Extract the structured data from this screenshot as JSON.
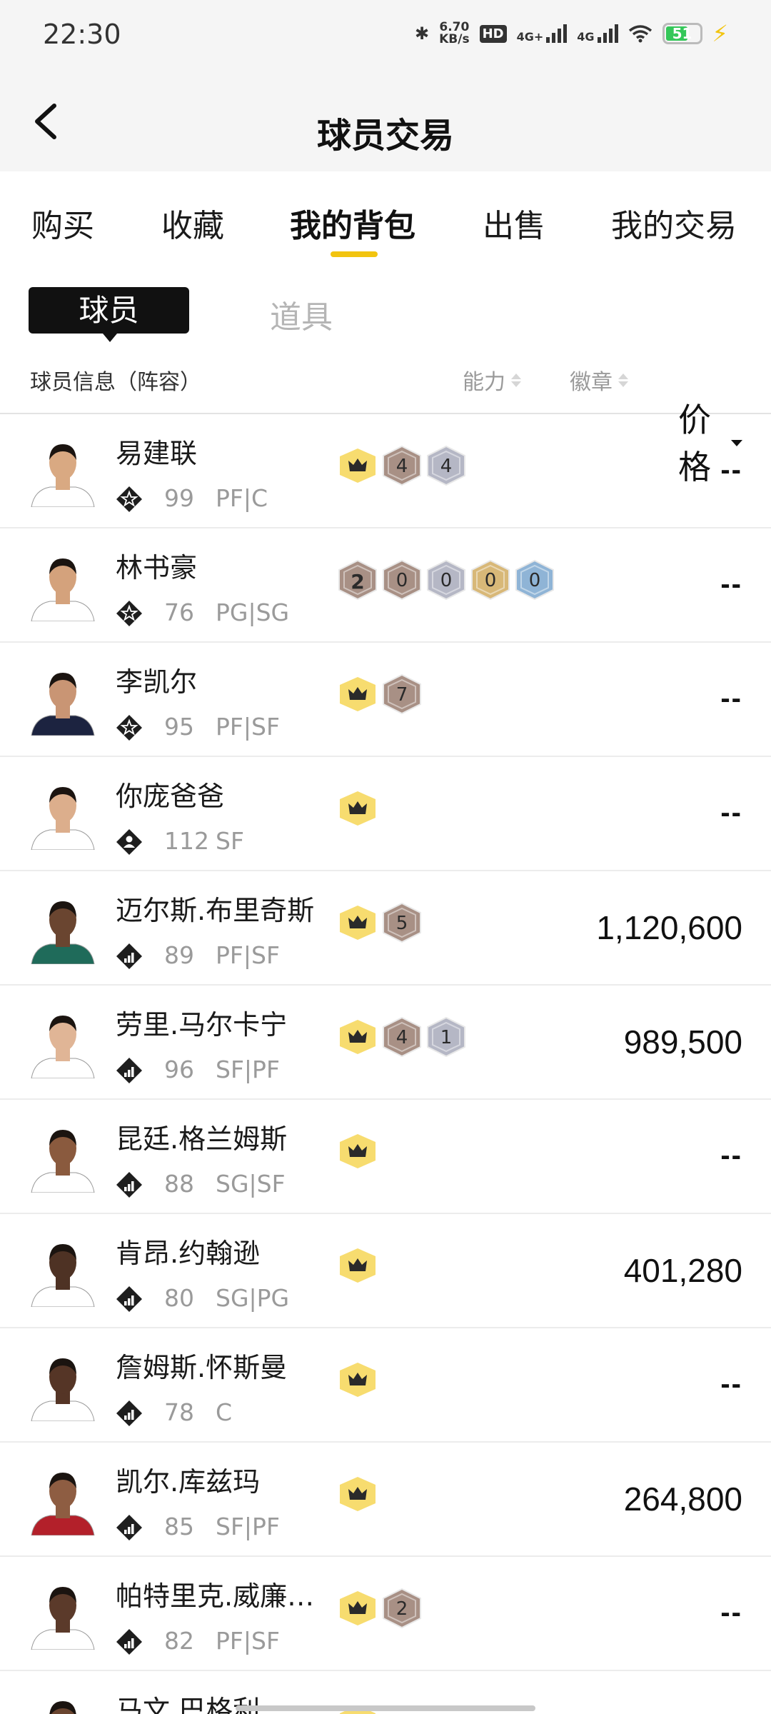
{
  "status_bar": {
    "time": "22:30",
    "net_speed_value": "6.70",
    "net_speed_unit": "KB/s",
    "hd_label": "HD",
    "sim1_label": "4G+",
    "sim2_label": "4G",
    "battery_level": "51"
  },
  "header": {
    "title": "球员交易"
  },
  "tabs": [
    {
      "label": "购买"
    },
    {
      "label": "收藏"
    },
    {
      "label": "我的背包"
    },
    {
      "label": "出售"
    },
    {
      "label": "我的交易"
    }
  ],
  "active_tab": "我的背包",
  "sub_tabs": {
    "player": "球员",
    "item": "道具"
  },
  "columns": {
    "info": "球员信息（阵容）",
    "ability": "能力",
    "badge": "徽章",
    "price": "价格"
  },
  "players": [
    {
      "name": "易建联",
      "rating": "99",
      "position": "PF|C",
      "tier": "star",
      "skin": "#d9a982",
      "jersey": "#ffffff",
      "badges": [
        {
          "kind": "crown"
        },
        {
          "kind": "hex",
          "num": "4",
          "color": "#a89085"
        },
        {
          "kind": "hex",
          "num": "4",
          "color": "#b5b7c5"
        }
      ],
      "price": "--"
    },
    {
      "name": "林书豪",
      "rating": "76",
      "position": "PG|SG",
      "tier": "star",
      "skin": "#d4a27c",
      "jersey": "#ffffff",
      "badges": [
        {
          "kind": "hex",
          "num": "2",
          "color": "#a89085",
          "bold": true
        },
        {
          "kind": "hex",
          "num": "0",
          "color": "#a89085"
        },
        {
          "kind": "hex",
          "num": "0",
          "color": "#b5b7c5"
        },
        {
          "kind": "hex",
          "num": "0",
          "color": "#d8b878"
        },
        {
          "kind": "hex",
          "num": "0",
          "color": "#8fb4d6"
        }
      ],
      "price": "--"
    },
    {
      "name": "李凯尔",
      "rating": "95",
      "position": "PF|SF",
      "tier": "star",
      "skin": "#c99574",
      "jersey": "#1c2340",
      "badges": [
        {
          "kind": "crown"
        },
        {
          "kind": "hex",
          "num": "7",
          "color": "#a89085"
        }
      ],
      "price": "--"
    },
    {
      "name": "你庞爸爸",
      "rating": "112",
      "position": "SF",
      "tier": "person",
      "skin": "#dcae8c",
      "jersey": "#ffffff",
      "badges": [
        {
          "kind": "crown"
        }
      ],
      "price": "--"
    },
    {
      "name": "迈尔斯.布里奇斯",
      "rating": "89",
      "position": "PF|SF",
      "tier": "bars",
      "skin": "#6a4530",
      "jersey": "#1f6b5a",
      "badges": [
        {
          "kind": "crown"
        },
        {
          "kind": "hex",
          "num": "5",
          "color": "#a89085"
        }
      ],
      "price": "1,120,600"
    },
    {
      "name": "劳里.马尔卡宁",
      "rating": "96",
      "position": "SF|PF",
      "tier": "bars",
      "skin": "#e0b596",
      "jersey": "#ffffff",
      "badges": [
        {
          "kind": "crown"
        },
        {
          "kind": "hex",
          "num": "4",
          "color": "#a89085"
        },
        {
          "kind": "hex",
          "num": "1",
          "color": "#b5b7c5"
        }
      ],
      "price": "989,500"
    },
    {
      "name": "昆廷.格兰姆斯",
      "rating": "88",
      "position": "SG|SF",
      "tier": "bars",
      "skin": "#8a5a3e",
      "jersey": "#ffffff",
      "badges": [
        {
          "kind": "crown"
        }
      ],
      "price": "--"
    },
    {
      "name": "肯昂.约翰逊",
      "rating": "80",
      "position": "SG|PG",
      "tier": "bars",
      "skin": "#4e3224",
      "jersey": "#ffffff",
      "badges": [
        {
          "kind": "crown"
        }
      ],
      "price": "401,280"
    },
    {
      "name": "詹姆斯.怀斯曼",
      "rating": "78",
      "position": "C",
      "tier": "bars",
      "skin": "#553526",
      "jersey": "#ffffff",
      "badges": [
        {
          "kind": "crown"
        }
      ],
      "price": "--"
    },
    {
      "name": "凯尔.库兹玛",
      "rating": "85",
      "position": "SF|PF",
      "tier": "bars",
      "skin": "#8e5d42",
      "jersey": "#b3202a",
      "badges": [
        {
          "kind": "crown"
        }
      ],
      "price": "264,800"
    },
    {
      "name": "帕特里克.威廉…",
      "rating": "82",
      "position": "PF|SF",
      "tier": "bars",
      "skin": "#5b3a2a",
      "jersey": "#ffffff",
      "badges": [
        {
          "kind": "crown"
        },
        {
          "kind": "hex",
          "num": "2",
          "color": "#a89085"
        }
      ],
      "price": "--"
    },
    {
      "name": "马文.巴格利",
      "rating": "",
      "position": "",
      "tier": "",
      "skin": "#6a4530",
      "jersey": "#ffffff",
      "badges": [
        {
          "kind": "crown"
        }
      ],
      "price": ""
    }
  ],
  "colors": {
    "accent": "#f2c40f",
    "crown_bg": "#f7dc6f",
    "bronze": "#a89085",
    "silver": "#b5b7c5",
    "gold": "#d8b878",
    "blue": "#8fb4d6"
  }
}
